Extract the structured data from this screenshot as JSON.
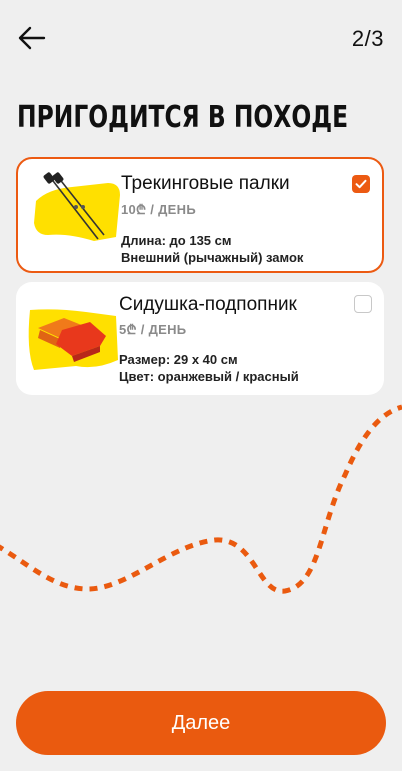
{
  "header": {
    "back_icon": "arrow-left-icon",
    "step": "2/3"
  },
  "title": "ПРИГОДИТСЯ В ПОХОДЕ",
  "items": [
    {
      "name": "Трекинговые палки",
      "price": "10₾ / ДЕНЬ",
      "spec1": "Длина: до 135 см",
      "spec2": "Внешний (рычажный) замок",
      "checked": true,
      "icon": "trekking-poles-image"
    },
    {
      "name": "Сидушка-подпопник",
      "price": "5₾ / ДЕНЬ",
      "spec1": "Размер: 29 х 40 см",
      "spec2": "Цвет: оранжевый / красный",
      "checked": false,
      "icon": "seat-pad-image"
    }
  ],
  "next_button": "Далее",
  "colors": {
    "accent": "#ea5a0f",
    "background": "#efefef",
    "card": "#ffffff",
    "thumb_bg": "#ffe000"
  }
}
